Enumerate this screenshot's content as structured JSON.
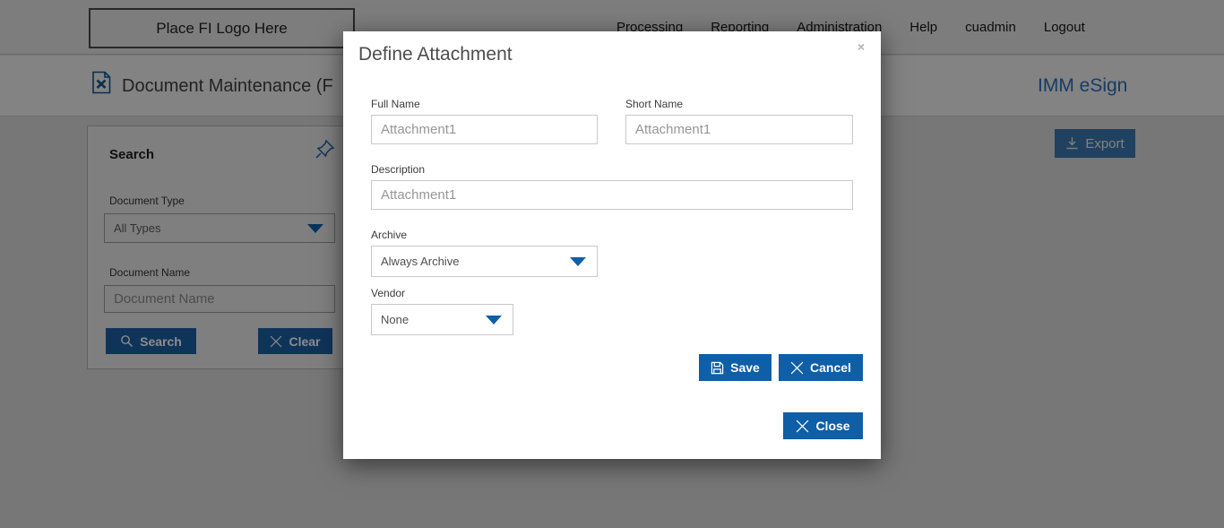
{
  "page": {
    "topbar": {
      "logo_placeholder": "Place FI Logo Here",
      "nav": [
        "Processing",
        "Reporting",
        "Administration",
        "Help",
        "cuadmin",
        "Logout"
      ]
    },
    "header": {
      "title": "Document Maintenance (F",
      "brand": "IMM eSign"
    },
    "search_panel": {
      "title": "Search",
      "document_type_label": "Document Type",
      "document_type_value": "All Types",
      "document_name_label": "Document Name",
      "document_name_placeholder": "Document Name",
      "search_label": "Search",
      "clear_label": "Clear"
    },
    "export_label": "Export"
  },
  "modal": {
    "title": "Define Attachment",
    "close_x": "×",
    "fields": {
      "full_name": {
        "label": "Full Name",
        "value": "Attachment1"
      },
      "short_name": {
        "label": "Short Name",
        "value": "Attachment1"
      },
      "description": {
        "label": "Description",
        "value": "Attachment1"
      },
      "archive": {
        "label": "Archive",
        "value": "Always Archive"
      },
      "vendor": {
        "label": "Vendor",
        "value": "None"
      }
    },
    "buttons": {
      "save": "Save",
      "cancel": "Cancel",
      "close": "Close"
    }
  },
  "colors": {
    "button_blue": "#0e5ea8",
    "navy_button": "#1d5fa5",
    "brand_blue": "#2a6db8",
    "overlay": "rgba(0,0,0,0.45)"
  }
}
